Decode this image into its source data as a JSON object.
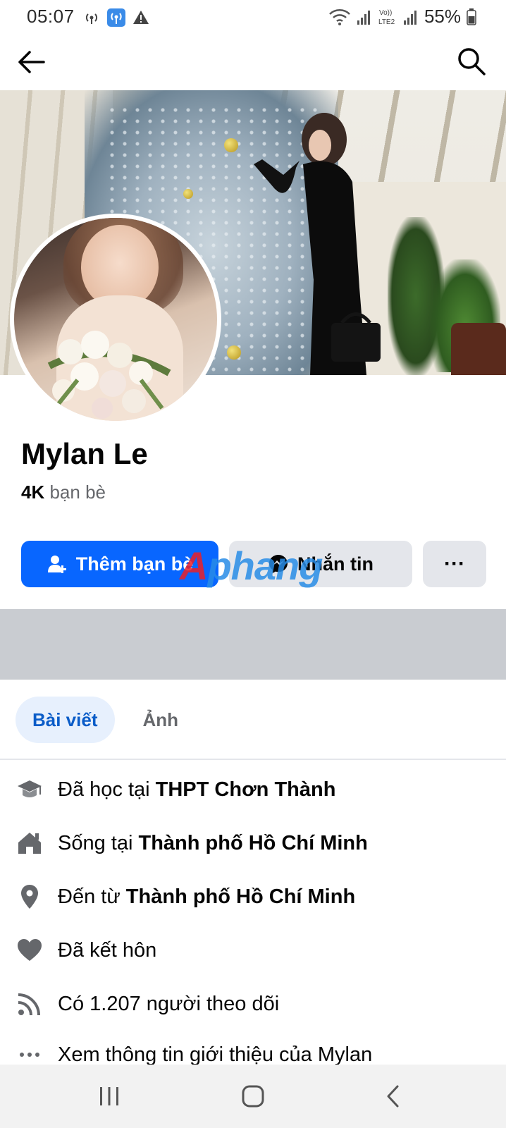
{
  "status_bar": {
    "time": "05:07",
    "battery": "55%",
    "left_icons": [
      "hotspot-icon",
      "wifi-calling-icon",
      "warning-icon"
    ],
    "right_icons": [
      "wifi-icon",
      "signal-icon",
      "volte-icon",
      "signal-icon",
      "battery-icon"
    ]
  },
  "app_bar": {
    "back_icon": "arrow-left-icon",
    "search_icon": "search-icon"
  },
  "profile": {
    "name": "Mylan Le",
    "friends_count": "4K",
    "friends_label": " bạn bè"
  },
  "actions": {
    "add_friend": "Thêm bạn bè",
    "message": "Nhắn tin",
    "more": "···"
  },
  "watermark": {
    "first": "A",
    "rest": "phang"
  },
  "tabs": [
    {
      "label": "Bài viết",
      "active": true
    },
    {
      "label": "Ảnh",
      "active": false
    }
  ],
  "intro": {
    "school_prefix": "Đã học tại ",
    "school_name": "THPT Chơn Thành",
    "lives_prefix": "Sống tại ",
    "lives_city": "Thành phố Hồ Chí Minh",
    "from_prefix": "Đến từ ",
    "from_city": "Thành phố Hồ Chí Minh",
    "relationship": "Đã kết hôn",
    "followers": "Có 1.207 người theo dõi",
    "see_about": "Xem thông tin giới thiệu của Mylan"
  },
  "colors": {
    "primary": "#0866ff",
    "secondary_button": "#e4e6eb",
    "separator": "#c9ccd1",
    "active_tab_bg": "#e7f0fd",
    "active_tab_text": "#0a5cc8",
    "muted_text": "#65676b"
  }
}
